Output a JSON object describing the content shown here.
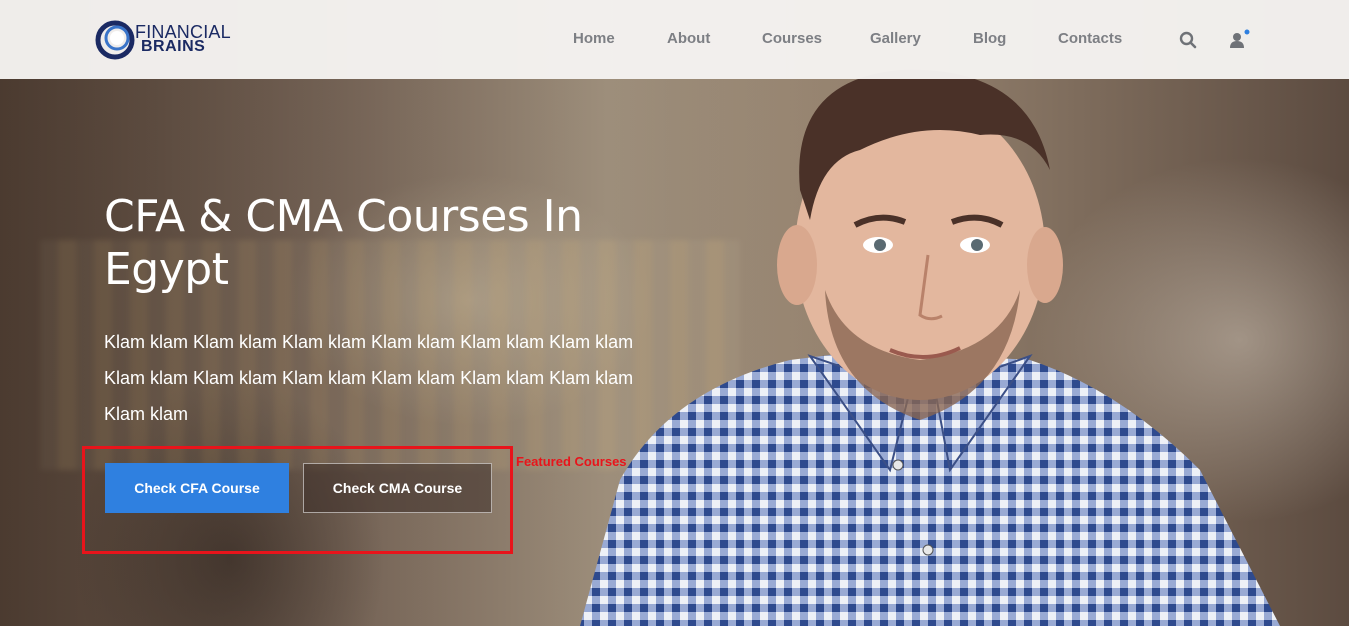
{
  "brand": {
    "line1": "FINANCIAL",
    "line2": "BRAINS",
    "color": "#1b2a63"
  },
  "nav": {
    "items": [
      {
        "label": "Home"
      },
      {
        "label": "About"
      },
      {
        "label": "Courses"
      },
      {
        "label": "Gallery"
      },
      {
        "label": "Blog"
      },
      {
        "label": "Contacts"
      }
    ],
    "search_icon": "search-icon",
    "user_icon": "user-icon",
    "notification_dot_color": "#2f80e0"
  },
  "hero": {
    "title": "CFA & CMA Courses In Egypt",
    "description": "Klam klam Klam klam Klam klam Klam klam Klam klam Klam klam Klam klam Klam klam Klam klam Klam klam Klam klam Klam klam Klam klam",
    "buttons": {
      "cfa_label": "Check CFA Course",
      "cma_label": "Check CMA Course"
    },
    "accent_color": "#2f80e0"
  },
  "annotation": {
    "label": "Featured Courses",
    "color": "#e8141b"
  }
}
